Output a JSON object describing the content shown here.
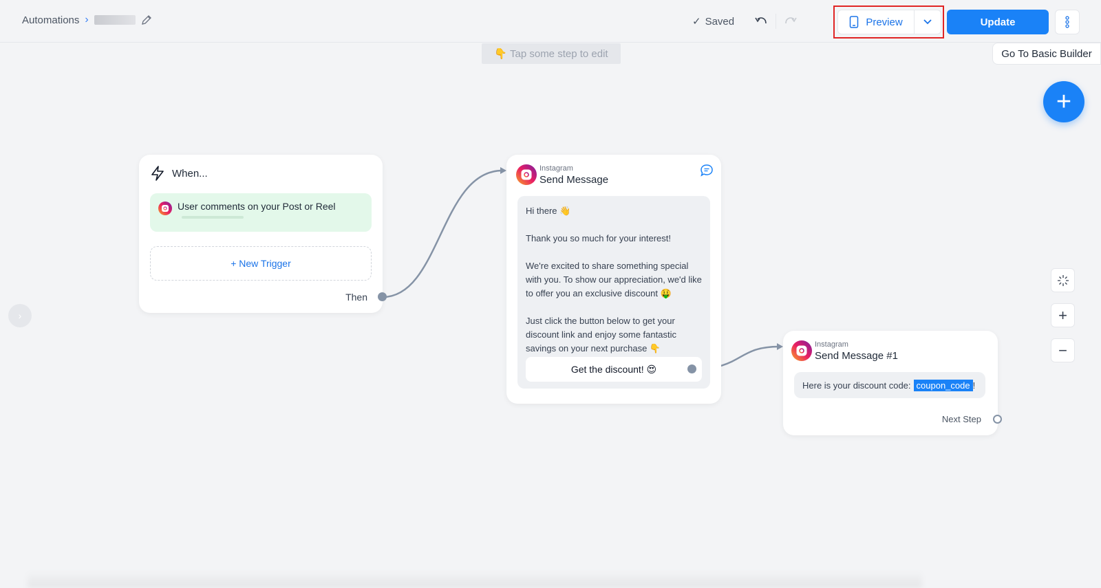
{
  "header": {
    "breadcrumb_root": "Automations",
    "save_status": "Saved",
    "preview_label": "Preview",
    "update_label": "Update"
  },
  "canvas": {
    "tip": "👇 Tap some step to edit",
    "basic_builder": "Go To Basic Builder"
  },
  "when_card": {
    "title": "When...",
    "trigger": "User comments on your Post or Reel",
    "new_trigger": "+ New Trigger",
    "then": "Then"
  },
  "send_card": {
    "kicker": "Instagram",
    "title": "Send Message",
    "message": "Hi there 👋\n\nThank you so much for your interest!\n\nWe're excited to share something special with you. To show our appreciation, we'd like to offer you an exclusive discount 🤑\n\nJust click the button below to get your discount link and enjoy some fantastic savings on your next purchase 👇",
    "cta": "Get the discount! 😍"
  },
  "send_card_2": {
    "kicker": "Instagram",
    "title": "Send Message #1",
    "code_prefix": "Here is your discount code: ",
    "coupon": "coupon_code",
    "code_suffix": "!",
    "next_step": "Next Step"
  },
  "tools": {
    "fab": "+",
    "zoom_in": "+",
    "zoom_out": "−"
  },
  "colors": {
    "accent": "#1a82f7",
    "highlight": "#e02424",
    "trigger_bg": "#e3f8ea"
  }
}
